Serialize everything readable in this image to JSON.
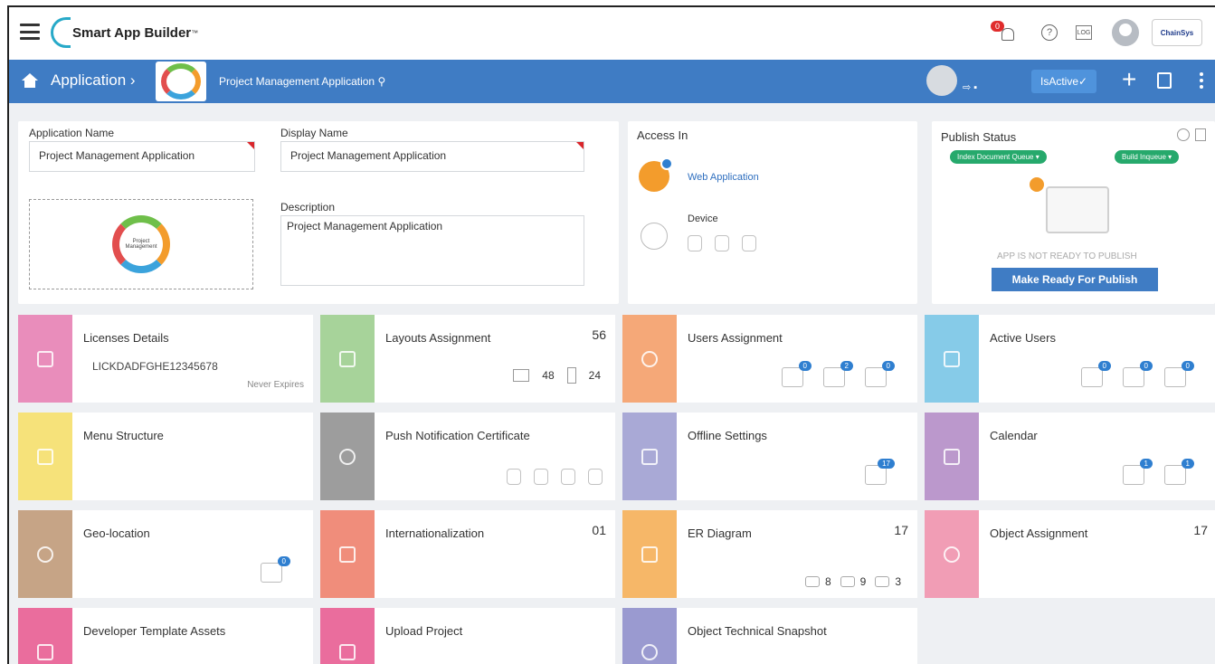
{
  "header": {
    "logo_text": "Smart App Builder",
    "logo_tm": "™",
    "notification_count": "0",
    "log_label": "LOG",
    "help_glyph": "?",
    "brand_label": "ChainSys"
  },
  "navbar": {
    "breadcrumb": "Application ›",
    "app_title": "Project Management Application",
    "search_glyph": "⚲",
    "status_label": "IsActive✓",
    "plus_glyph": "+"
  },
  "form": {
    "application_name_label": "Application Name",
    "application_name_value": "Project Management Application",
    "display_name_label": "Display Name",
    "display_name_value": "Project Management Application",
    "description_label": "Description",
    "description_value": "Project Management Application",
    "logo_caption": "Project Management"
  },
  "access": {
    "title": "Access In",
    "web_label": "Web Application",
    "device_label": "Device"
  },
  "publish": {
    "title": "Publish Status",
    "index_queue": "Index Document Queue ▾",
    "build_queue": "Build Inqueue ▾",
    "not_ready": "APP IS NOT READY TO PUBLISH",
    "make_ready": "Make Ready For Publish"
  },
  "tiles": [
    {
      "title": "Licenses Details",
      "color": "#e98dbb",
      "sub": "LICKDADFGHE12345678",
      "note": "Never Expires"
    },
    {
      "title": "Layouts Assignment",
      "color": "#a7d39a",
      "count": "56",
      "desktop": "48",
      "mobile": "24"
    },
    {
      "title": "Users Assignment",
      "color": "#f5a878",
      "badges": [
        "0",
        "2",
        "0"
      ]
    },
    {
      "title": "Active Users",
      "color": "#86cbe8",
      "badges": [
        "0",
        "0",
        "0"
      ]
    },
    {
      "title": "Menu Structure",
      "color": "#f6e27a"
    },
    {
      "title": "Push Notification Certificate",
      "color": "#9d9d9d"
    },
    {
      "title": "Offline Settings",
      "color": "#a9a9d6",
      "badges": [
        "17"
      ]
    },
    {
      "title": "Calendar",
      "color": "#bb98cc",
      "badges": [
        "1",
        "1"
      ]
    },
    {
      "title": "Geo-location",
      "color": "#c6a486",
      "badges": [
        "0"
      ]
    },
    {
      "title": "Internationalization",
      "color": "#f08d7b",
      "count": "01"
    },
    {
      "title": "ER Diagram",
      "color": "#f6b768",
      "count": "17",
      "stats": [
        "8",
        "9",
        "3"
      ]
    },
    {
      "title": "Object Assignment",
      "color": "#f19db5",
      "count": "17"
    },
    {
      "title": "Developer Template Assets",
      "color": "#ea6d9d"
    },
    {
      "title": "Upload Project",
      "color": "#ea6d9d"
    },
    {
      "title": "Object Technical Snapshot",
      "color": "#9a9ad0"
    }
  ]
}
